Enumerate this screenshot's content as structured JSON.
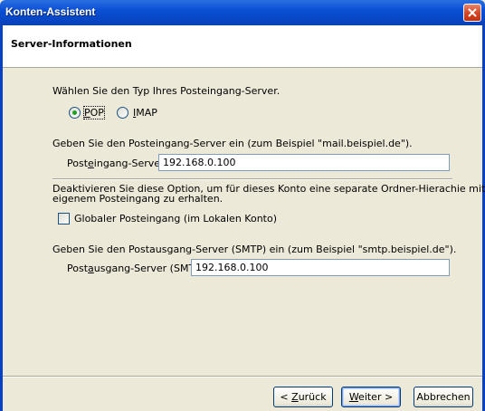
{
  "window": {
    "title": "Konten-Assistent"
  },
  "header": {
    "title": "Server-Informationen"
  },
  "incoming": {
    "type_prompt": "Wählen Sie den Typ Ihres Posteingang-Server.",
    "options": [
      {
        "pre": "",
        "mnemonic": "P",
        "post": "OP",
        "selected": true
      },
      {
        "pre": "",
        "mnemonic": "I",
        "post": "MAP",
        "selected": false
      }
    ],
    "server_prompt": "Geben Sie den Posteingang-Server ein (zum Beispiel \"mail.beispiel.de\").",
    "server_label_pre": "Post",
    "server_label_mnemonic": "e",
    "server_label_post": "ingang-Server:",
    "server_value": "192.168.0.100"
  },
  "global_inbox": {
    "description_line1": "Deaktivieren Sie diese Option, um für dieses Konto eine separate Ordner-Hierachie mit",
    "description_line2": "eigenem Posteingang zu erhalten.",
    "checkbox_label": "Globaler Posteingang (im Lokalen Konto)",
    "checked": false
  },
  "outgoing": {
    "server_prompt": "Geben Sie den Postausgang-Server (SMTP) ein (zum Beispiel \"smtp.beispiel.de\").",
    "server_label_pre": "Post",
    "server_label_mnemonic": "a",
    "server_label_post": "usgang-Server (SMTP):",
    "server_value": "192.168.0.100"
  },
  "buttons": {
    "back_pre": "< ",
    "back_mnemonic": "Z",
    "back_post": "urück",
    "next_mnemonic": "W",
    "next_post": "eiter >",
    "cancel": "Abbrechen"
  }
}
